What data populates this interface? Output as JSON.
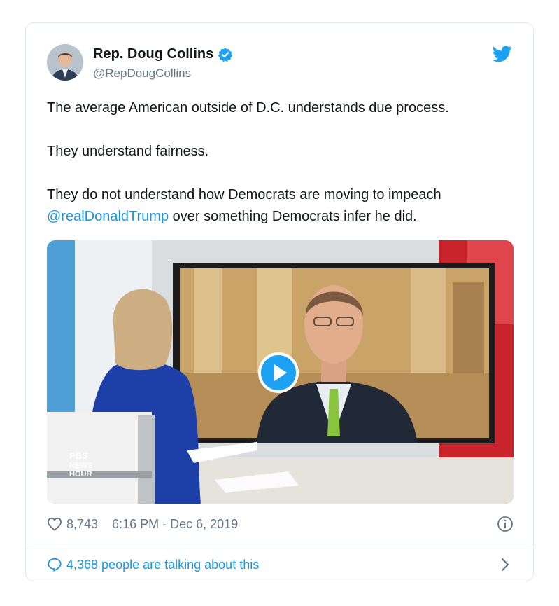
{
  "author": {
    "display_name": "Rep. Doug Collins",
    "handle": "@RepDougCollins",
    "verified": true
  },
  "tweet": {
    "line1": "The average American outside of D.C. understands due process.",
    "line2": "They understand fairness.",
    "line3a": "They do not understand how Democrats are moving to impeach",
    "mention": "@realDonaldTrump",
    "line3b": " over something Democrats infer he did."
  },
  "media": {
    "type": "video",
    "watermark": "PBS NEWS HOUR"
  },
  "meta": {
    "likes": "8,743",
    "timestamp": "6:16 PM - Dec 6, 2019"
  },
  "talking": {
    "label": "4,368 people are talking about this"
  },
  "colors": {
    "accent": "#1da1f2",
    "link": "#1b95e0",
    "muted": "#657786"
  },
  "icons": [
    "verified-badge-icon",
    "twitter-bird-icon",
    "play-icon",
    "heart-icon",
    "info-icon",
    "speech-bubble-icon",
    "chevron-right-icon"
  ]
}
